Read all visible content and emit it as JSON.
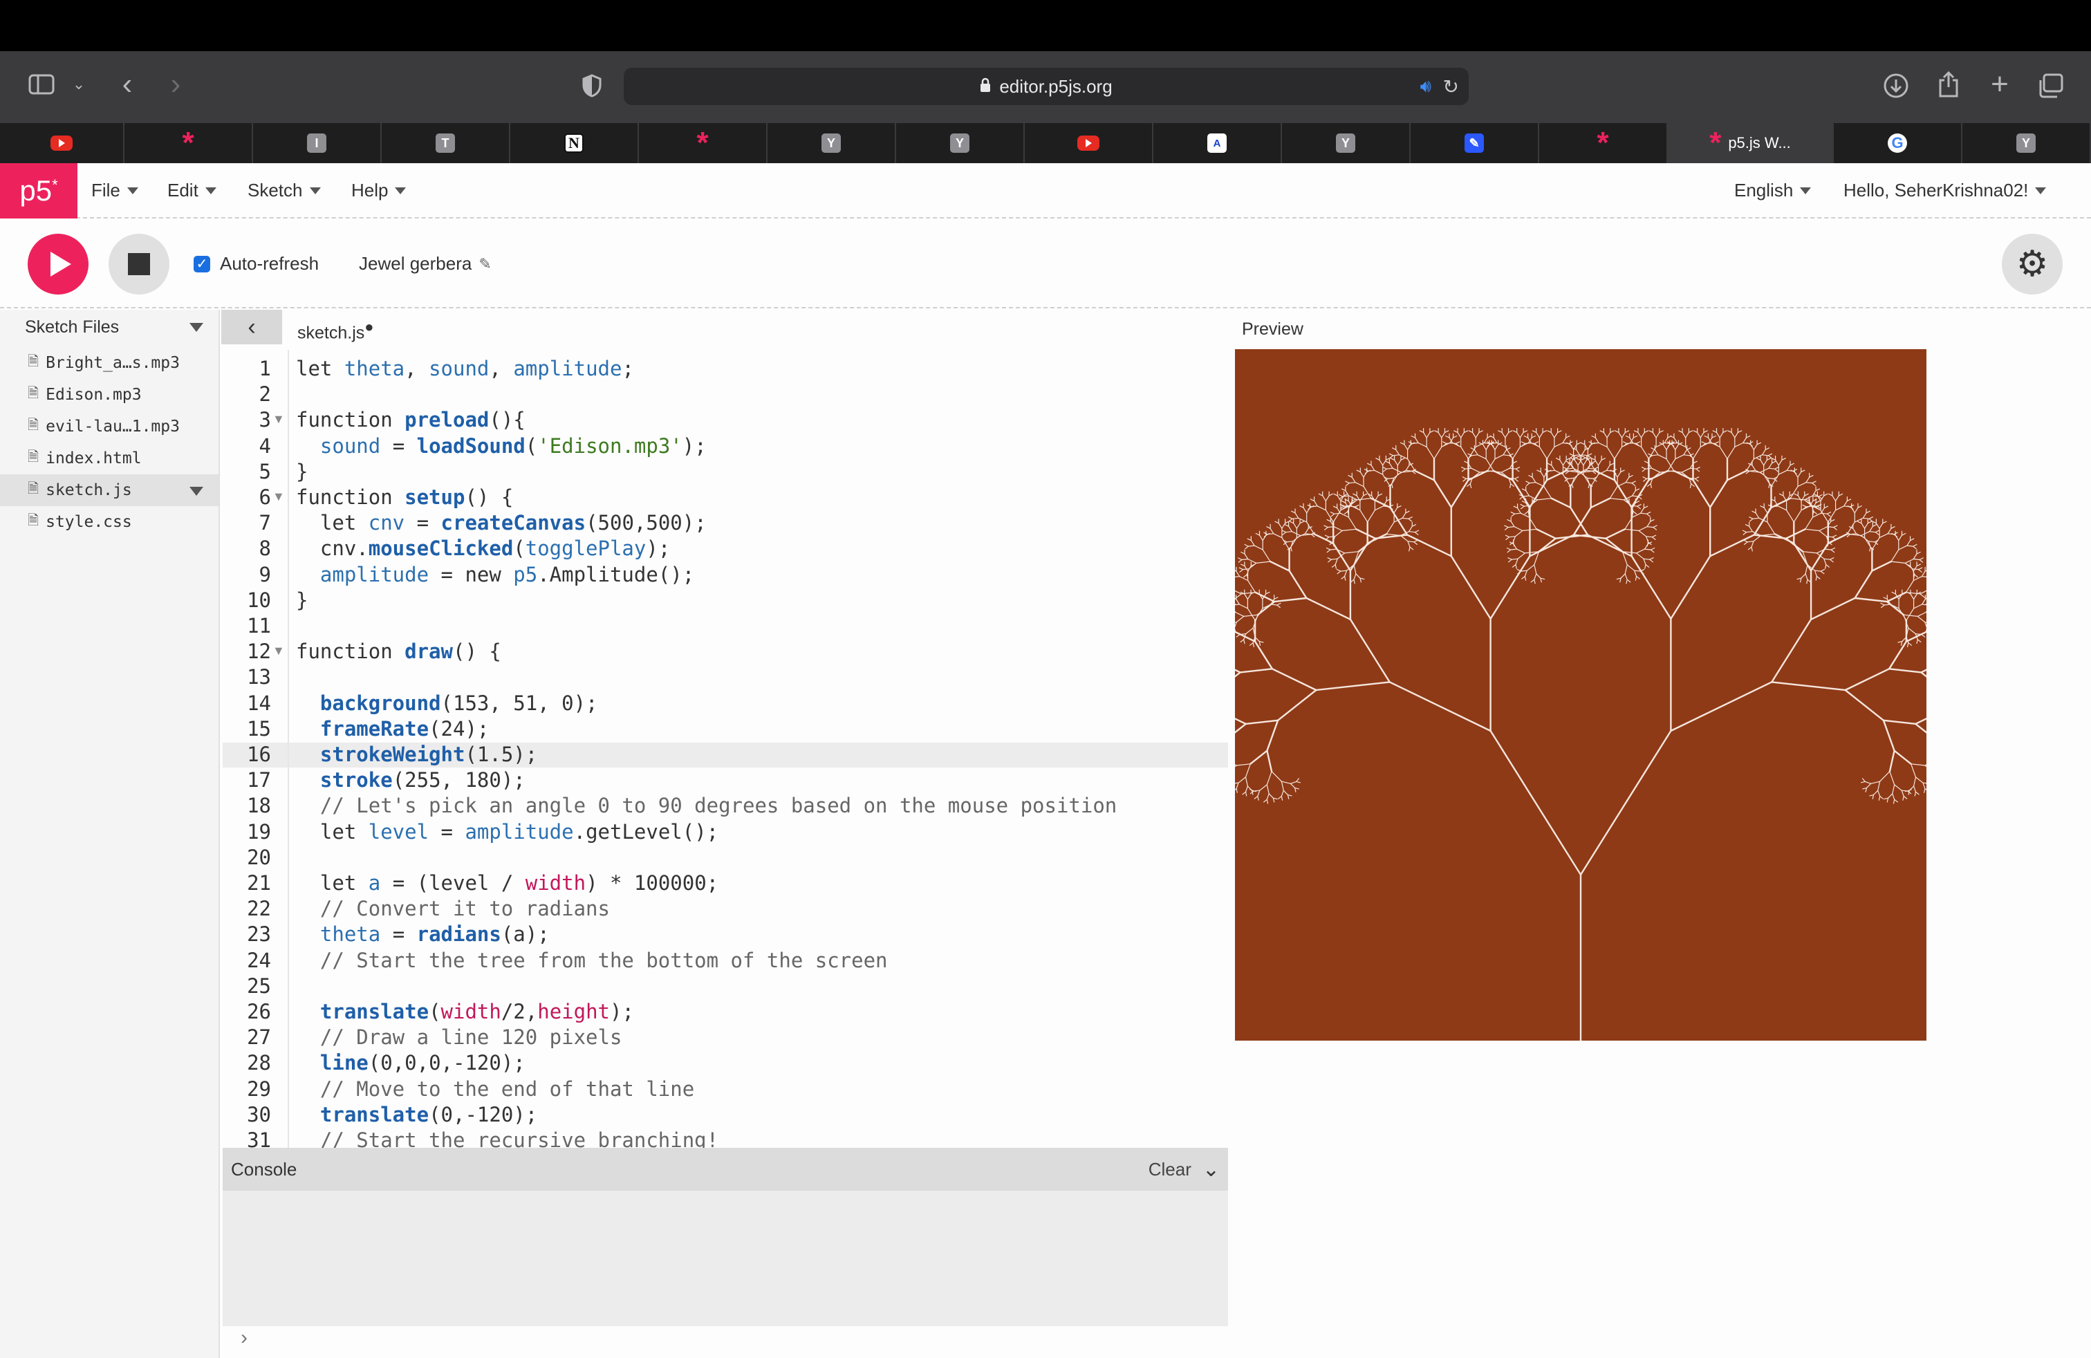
{
  "browser": {
    "url": "editor.p5js.org",
    "tabs": [
      {
        "icon": "youtube-icon",
        "label": ""
      },
      {
        "icon": "p5-star-icon",
        "label": "*"
      },
      {
        "icon": "letter-i-icon",
        "label": "I"
      },
      {
        "icon": "letter-t-icon",
        "label": "T"
      },
      {
        "icon": "notion-icon",
        "label": "N"
      },
      {
        "icon": "p5-star-icon",
        "label": "*"
      },
      {
        "icon": "y-icon",
        "label": "Y"
      },
      {
        "icon": "y-icon",
        "label": "Y"
      },
      {
        "icon": "youtube-icon",
        "label": ""
      },
      {
        "icon": "a-icon",
        "label": "A"
      },
      {
        "icon": "y-icon",
        "label": "Y"
      },
      {
        "icon": "pen-icon",
        "label": "✎"
      },
      {
        "icon": "p5-star-icon",
        "label": "*"
      },
      {
        "icon": "p5-star-icon",
        "label": "*",
        "title": "p5.js W...",
        "active": true
      },
      {
        "icon": "google-icon",
        "label": "G"
      },
      {
        "icon": "y-icon",
        "label": "Y"
      }
    ]
  },
  "menubar": {
    "logo": "p5",
    "logo_sup": "*",
    "file": "File",
    "edit": "Edit",
    "sketch": "Sketch",
    "help": "Help",
    "language": "English",
    "user": "Hello, SeherKrishna02!"
  },
  "controls": {
    "auto_refresh": "Auto-refresh",
    "auto_refresh_checked": true,
    "sketch_name": "Jewel gerbera"
  },
  "sidebar": {
    "title": "Sketch Files",
    "files": [
      {
        "name": "Bright_a…s.mp3"
      },
      {
        "name": "Edison.mp3"
      },
      {
        "name": "evil-lau…1.mp3"
      },
      {
        "name": "index.html"
      },
      {
        "name": "sketch.js",
        "selected": true
      },
      {
        "name": "style.css"
      }
    ]
  },
  "editor": {
    "file_tab": "sketch.js",
    "file_tab_mark": "●",
    "active_line": 16,
    "lines": [
      [
        [
          "kw",
          "let "
        ],
        [
          "v",
          "theta"
        ],
        [
          "o",
          ", "
        ],
        [
          "v",
          "sound"
        ],
        [
          "o",
          ", "
        ],
        [
          "v",
          "amplitude"
        ],
        [
          "o",
          ";"
        ]
      ],
      [],
      [
        [
          "kw",
          "function "
        ],
        [
          "f",
          "preload"
        ],
        [
          "o",
          "(){"
        ]
      ],
      [
        [
          "o",
          "  "
        ],
        [
          "v",
          "sound"
        ],
        [
          "o",
          " = "
        ],
        [
          "f",
          "loadSound"
        ],
        [
          "o",
          "("
        ],
        [
          "s",
          "'Edison.mp3'"
        ],
        [
          "o",
          ");"
        ]
      ],
      [
        [
          "o",
          "}"
        ]
      ],
      [
        [
          "kw",
          "function "
        ],
        [
          "f",
          "setup"
        ],
        [
          "o",
          "() {"
        ]
      ],
      [
        [
          "o",
          "  "
        ],
        [
          "kw",
          "let "
        ],
        [
          "v",
          "cnv"
        ],
        [
          "o",
          " = "
        ],
        [
          "f",
          "createCanvas"
        ],
        [
          "o",
          "(500,500);"
        ]
      ],
      [
        [
          "o",
          "  cnv."
        ],
        [
          "f",
          "mouseClicked"
        ],
        [
          "o",
          "("
        ],
        [
          "v",
          "togglePlay"
        ],
        [
          "o",
          ");"
        ]
      ],
      [
        [
          "o",
          "  "
        ],
        [
          "v",
          "amplitude"
        ],
        [
          "o",
          " = "
        ],
        [
          "kw",
          "new "
        ],
        [
          "v",
          "p5"
        ],
        [
          "o",
          ".Amplitude();"
        ]
      ],
      [
        [
          "o",
          "}"
        ]
      ],
      [],
      [
        [
          "kw",
          "function "
        ],
        [
          "f",
          "draw"
        ],
        [
          "o",
          "() {"
        ]
      ],
      [],
      [
        [
          "o",
          "  "
        ],
        [
          "f",
          "background"
        ],
        [
          "o",
          "(153, 51, 0);"
        ]
      ],
      [
        [
          "o",
          "  "
        ],
        [
          "f",
          "frameRate"
        ],
        [
          "o",
          "(24);"
        ]
      ],
      [
        [
          "o",
          "  "
        ],
        [
          "f",
          "strokeWeight"
        ],
        [
          "o",
          "(1.5);"
        ]
      ],
      [
        [
          "o",
          "  "
        ],
        [
          "f",
          "stroke"
        ],
        [
          "o",
          "(255, 180);"
        ]
      ],
      [
        [
          "c",
          "  // Let's pick an angle 0 to 90 degrees based on the mouse position"
        ]
      ],
      [
        [
          "o",
          "  "
        ],
        [
          "kw",
          "let "
        ],
        [
          "v",
          "level"
        ],
        [
          "o",
          " = "
        ],
        [
          "v",
          "amplitude"
        ],
        [
          "o",
          ".getLevel();"
        ]
      ],
      [],
      [
        [
          "o",
          "  "
        ],
        [
          "kw",
          "let "
        ],
        [
          "v",
          "a"
        ],
        [
          "o",
          " = (level / "
        ],
        [
          "p",
          "width"
        ],
        [
          "o",
          ") * 100000;"
        ]
      ],
      [
        [
          "c",
          "  // Convert it to radians"
        ]
      ],
      [
        [
          "o",
          "  "
        ],
        [
          "v",
          "theta"
        ],
        [
          "o",
          " = "
        ],
        [
          "f",
          "radians"
        ],
        [
          "o",
          "(a);"
        ]
      ],
      [
        [
          "c",
          "  // Start the tree from the bottom of the screen"
        ]
      ],
      [],
      [
        [
          "o",
          "  "
        ],
        [
          "f",
          "translate"
        ],
        [
          "o",
          "("
        ],
        [
          "p",
          "width"
        ],
        [
          "o",
          "/2,"
        ],
        [
          "p",
          "height"
        ],
        [
          "o",
          ");"
        ]
      ],
      [
        [
          "c",
          "  // Draw a line 120 pixels"
        ]
      ],
      [
        [
          "o",
          "  "
        ],
        [
          "f",
          "line"
        ],
        [
          "o",
          "(0,0,0,-120);"
        ]
      ],
      [
        [
          "c",
          "  // Move to the end of that line"
        ]
      ],
      [
        [
          "o",
          "  "
        ],
        [
          "f",
          "translate"
        ],
        [
          "o",
          "(0,-120);"
        ]
      ],
      [
        [
          "c",
          "  // Start the recursive branching!"
        ]
      ]
    ],
    "fold_lines": [
      3,
      6,
      12
    ]
  },
  "console": {
    "title": "Console",
    "clear": "Clear",
    "prompt": "›"
  },
  "preview": {
    "label": "Preview",
    "background": "#8e3a17",
    "stroke": "#f6e6dd"
  },
  "colors": {
    "accent": "#ed225d",
    "checkbox": "#1a6fe0"
  }
}
